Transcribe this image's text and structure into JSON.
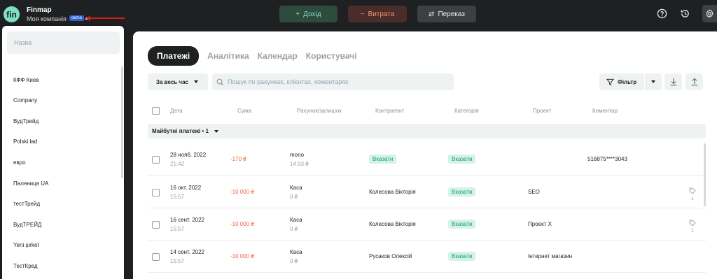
{
  "topbar": {
    "logo_text": "fin",
    "app_name": "Finmap",
    "company_name": "Моя компанія",
    "demo_badge": "demo",
    "income_label": "Дохід",
    "expense_label": "Витрата",
    "transfer_label": "Переказ",
    "income_icon": "+",
    "expense_icon": "−",
    "transfer_icon": "⇄"
  },
  "tabs": [
    "Платежі",
    "Аналітика",
    "Календар",
    "Користувачі"
  ],
  "toolbar": {
    "period_label": "За весь час",
    "search_placeholder": "Пошук по рахунках, клієнтах, коментарях",
    "filter_label": "Фільтр"
  },
  "columns": [
    "Дата",
    "Сума",
    "Рахунок/залишок",
    "Контрагент",
    "Категорія",
    "Проект",
    "Коментар"
  ],
  "group": {
    "label": "Майбутні платежі • 1"
  },
  "rows": [
    {
      "date": "28 нояб. 2022",
      "time": "21:42",
      "amount": "-170 ₴",
      "account": "mono",
      "balance": "14.93 ₴",
      "counterparty": "",
      "counterparty_tag": "Вказати",
      "category_tag": "Вказати",
      "project": "",
      "comment": "516875****3043",
      "tag_count": ""
    },
    {
      "date": "16 окт. 2022",
      "time": "15:57",
      "amount": "-10 000 ₴",
      "account": "Каса",
      "balance": "0 ₴",
      "counterparty": "Колесова Вікторія",
      "counterparty_tag": "",
      "category_tag": "Вказати",
      "project": "SEO",
      "comment": "",
      "tag_count": "1"
    },
    {
      "date": "16 сент. 2022",
      "time": "15:57",
      "amount": "-10 000 ₴",
      "account": "Каса",
      "balance": "0 ₴",
      "counterparty": "Колесова Вікторія",
      "counterparty_tag": "",
      "category_tag": "Вказати",
      "project": "Проект Х",
      "comment": "",
      "tag_count": "1"
    },
    {
      "date": "14 сент. 2022",
      "time": "15:57",
      "amount": "-10 000 ₴",
      "account": "Каса",
      "balance": "0 ₴",
      "counterparty": "Русаков Олексій",
      "counterparty_tag": "",
      "category_tag": "Вказати",
      "project": "Інтернет магазин",
      "comment": "",
      "tag_count": ""
    }
  ],
  "dropdown": {
    "search_placeholder": "Назва",
    "items": [
      "КФФ Киев",
      "Company",
      "ВудТрейд",
      "Polski ład",
      "евро",
      "Паляниця UA",
      "тестТрейд",
      "ВудТРЕЙД",
      "Yeni şirket",
      "ТестКред"
    ]
  },
  "colors": {
    "accent_green": "#7ee0c3",
    "negative": "#f0683f",
    "tag_bg": "#d4f3e8",
    "tag_text": "#1a9d73",
    "dark": "#1f2021"
  }
}
